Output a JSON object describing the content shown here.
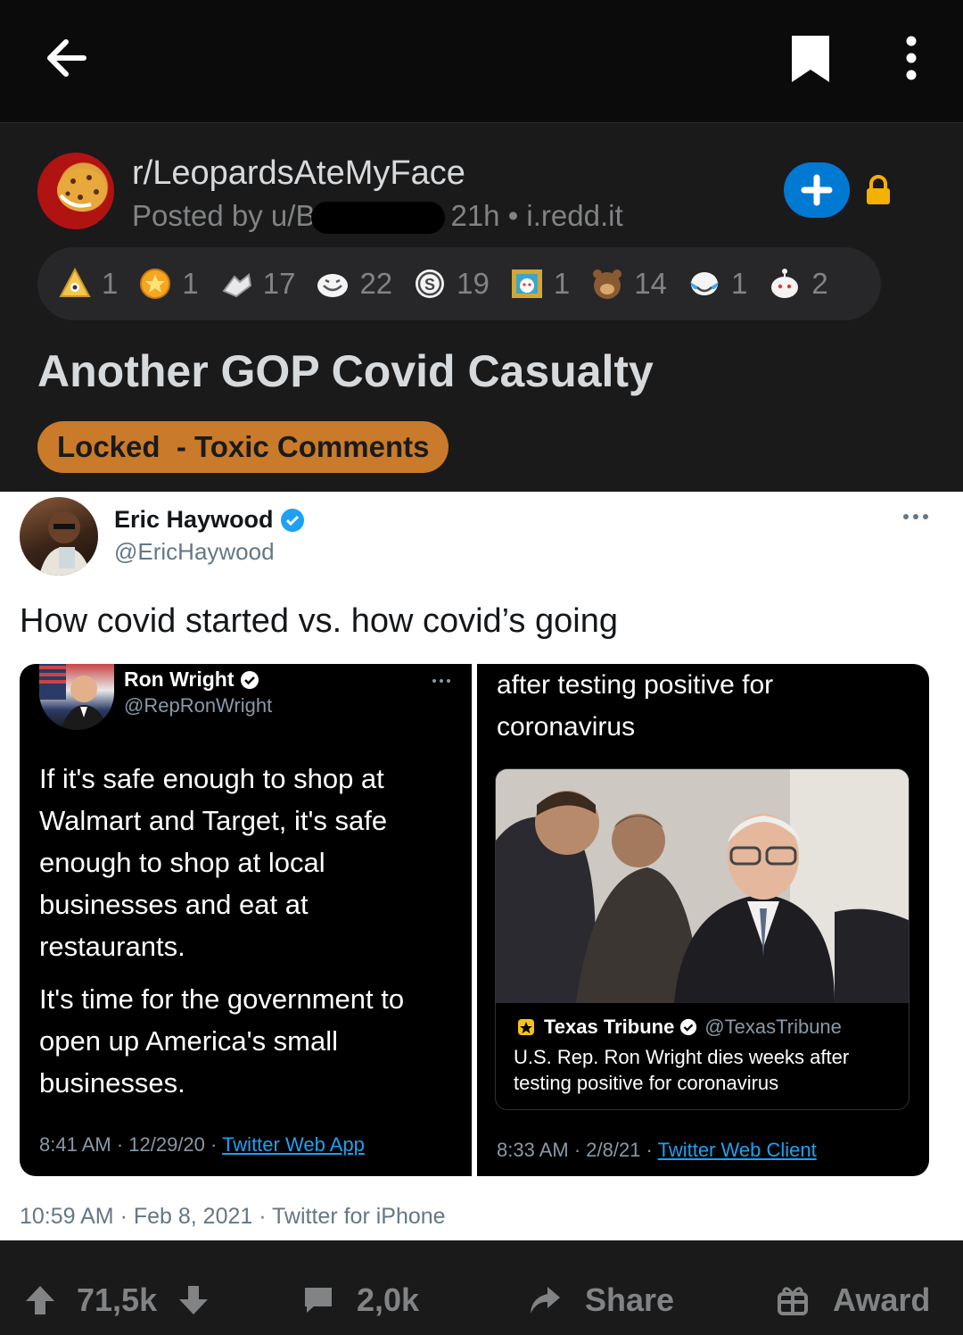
{
  "colors": {
    "topbar": "#0b0b0b",
    "post_bg": "#1a1a1b",
    "join": "#0079d3",
    "lock": "#f6b100",
    "flair_bg": "#c97a2a",
    "twitter_blue": "#1da1f2",
    "verified": "#1da1f2"
  },
  "topbar": {
    "back_icon": "arrow-left-icon",
    "bookmark_icon": "bookmark-icon",
    "more_icon": "vertical-dots-icon"
  },
  "post": {
    "subreddit": "r/LeopardsAteMyFace",
    "posted_by": "Posted by u/B",
    "age_source": "21h • i.redd.it",
    "title": "Another GOP Covid Casualty",
    "flair": "Locked  - Toxic Comments",
    "awards": [
      {
        "icon": "platinum-award-icon",
        "count": "1"
      },
      {
        "icon": "gold-award-icon",
        "count": "1"
      },
      {
        "icon": "hands-shake-award-icon",
        "count": "17"
      },
      {
        "icon": "laughing-award-icon",
        "count": "22"
      },
      {
        "icon": "s-coin-award-icon",
        "count": "19"
      },
      {
        "icon": "framed-snoo-award-icon",
        "count": "1"
      },
      {
        "icon": "facepalm-bear-award-icon",
        "count": "14"
      },
      {
        "icon": "crying-laughing-award-icon",
        "count": "1"
      },
      {
        "icon": "snoo-award-icon",
        "count": "2"
      }
    ]
  },
  "tweet": {
    "name": "Eric Haywood",
    "handle": "@EricHaywood",
    "text": "How covid started vs. how covid’s going",
    "footer": "10:59 AM · Feb 8, 2021 · Twitter for iPhone",
    "left_panel": {
      "name": "Ron Wright",
      "handle": "@RepRonWright",
      "p1": "If it's safe enough to shop at Walmart and Target, it's safe enough to shop at local businesses and eat at restaurants.",
      "p2": "It's time for the government to open up America's small businesses.",
      "meta": "8:41 AM · 12/29/20 · ",
      "meta_link": "Twitter Web App"
    },
    "right_panel": {
      "top_text": "after testing positive for coronavirus",
      "source_name": "Texas Tribune",
      "source_handle": "@TexasTribune",
      "headline": "U.S. Rep. Ron Wright dies weeks after testing positive for coronavirus",
      "meta": "8:33 AM · 2/8/21 · ",
      "meta_link": "Twitter Web Client"
    }
  },
  "bottombar": {
    "score": "71,5k",
    "comments": "2,0k",
    "share": "Share",
    "award": "Award"
  }
}
